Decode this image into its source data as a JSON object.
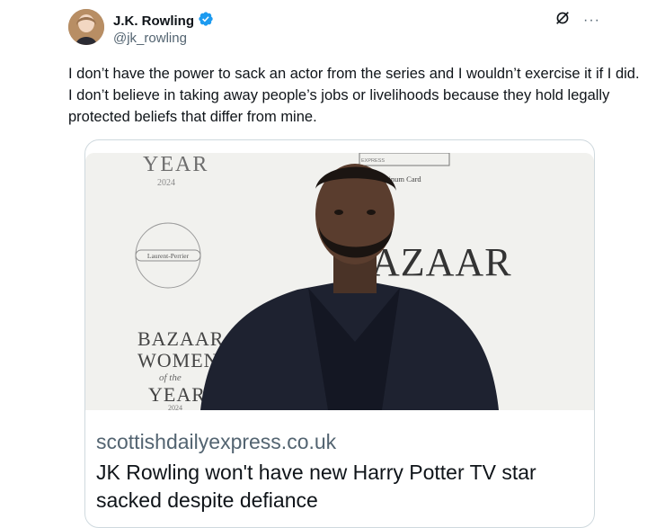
{
  "author": {
    "display_name": "J.K. Rowling",
    "handle": "@jk_rowling",
    "verified": true
  },
  "icons": {
    "verified": "verified-badge-icon",
    "grok": "grok-icon",
    "more": "more-icon"
  },
  "more_glyph": "···",
  "tweet_text": "I don’t have the power to sack an actor from the series and I wouldn’t exercise it if I did. I don’t believe in taking away people’s jobs or livelihoods because they hold legally protected beliefs that differ from mine.",
  "card": {
    "domain": "scottishdailyexpress.co.uk",
    "title": "JK Rowling won't have new Harry Potter TV star sacked despite defiance",
    "image": {
      "backdrop_top": "YEAR",
      "backdrop_year": "2024",
      "seal_text": "Laurent-Perrier",
      "sponsor_text": "The Platinum Card",
      "sponsor_small": "EXPRESS",
      "bazaar_right": "AZAAR",
      "bazaar_left": "BAZAAR",
      "women": "WOMEN",
      "of_the": "of the",
      "year_bottom": "YEAR",
      "year_bottom_num": "2024"
    }
  },
  "colors": {
    "verified_blue": "#1d9bf0",
    "text_primary": "#0f1419",
    "text_secondary": "#536471",
    "card_border": "#cfd9de"
  }
}
